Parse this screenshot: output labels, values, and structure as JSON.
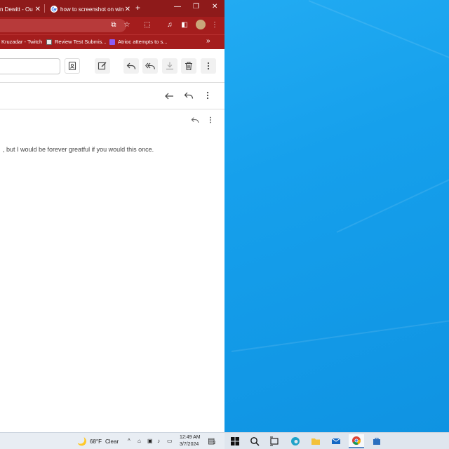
{
  "browser": {
    "tabs": [
      {
        "label": "n Dewitt - Ou",
        "active": false
      },
      {
        "label": "how to screenshot on win",
        "active": true
      }
    ],
    "bookmarks": [
      {
        "label": "Kruzadar - Twitch"
      },
      {
        "label": "Review Test Submis..."
      },
      {
        "label": "Atrioc attempts to s..."
      }
    ],
    "more_bookmarks": "»",
    "colors": {
      "frame": "#8e1a1a",
      "toolbar": "#a41d1d"
    }
  },
  "mail": {
    "body_text": ", but I would be forever greatful if you would this once."
  },
  "taskbar": {
    "weather": {
      "temp": "68°F",
      "condition": "Clear"
    },
    "clock": {
      "time": "12:49 AM",
      "date": "3/7/2024"
    },
    "notification_count": "2"
  }
}
